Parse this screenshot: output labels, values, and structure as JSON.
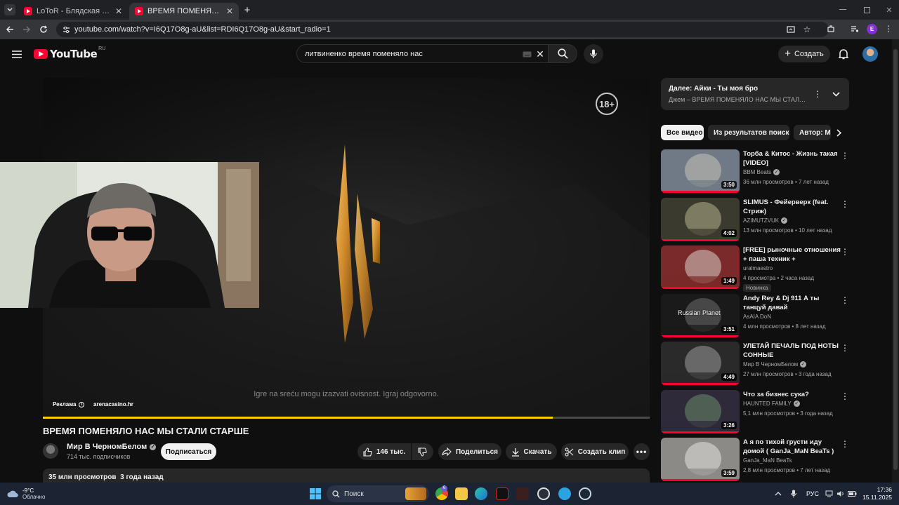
{
  "browser": {
    "tabs": [
      {
        "title": "LoToR - Блядская натура - YouT",
        "active": false
      },
      {
        "title": "ВРЕМЯ ПОМЕНЯЛО НАС МЫ С",
        "active": true
      }
    ],
    "new_tab_label": "+",
    "url": "youtube.com/watch?v=I6Q17O8g-aU&list=RDI6Q17O8g-aU&start_radio=1",
    "profile_letter": "E"
  },
  "youtube": {
    "logo_text": "YouTube",
    "country_code": "RU",
    "search_query": "литвиненко время поменяло нас",
    "create_label": "Создать"
  },
  "player": {
    "age_badge": "18+",
    "disclaimer": "Igre na sreću mogu izazvati ovisnost. Igraj odgovorno.",
    "ad_label": "Реклама",
    "ad_site": "arenacasino.hr",
    "progress_fraction": 0.84
  },
  "video": {
    "title": "ВРЕМЯ ПОМЕНЯЛО НАС МЫ СТАЛИ СТАРШЕ",
    "channel": "Мир В ЧерномБелом",
    "subscribers": "714 тыс. подписчиков",
    "subscribe_label": "Подписаться",
    "likes": "146 тыс.",
    "share_label": "Поделиться",
    "download_label": "Скачать",
    "clip_label": "Создать клип",
    "views_date": "35 млн просмотров  3 года назад"
  },
  "up_next": {
    "title": "Далее: Айки - Ты моя бро",
    "subtitle": "Джем – ВРЕМЯ ПОМЕНЯЛО НАС МЫ СТАЛИ СТА..."
  },
  "chips": [
    "Все видео",
    "Из результатов поиска",
    "Автор: Мир"
  ],
  "recommendations": [
    {
      "title": "Торба & Китос - Жизнь такая [VIDEO]",
      "channel": "BBM Beats",
      "verified": true,
      "meta": "36 млн просмотров • 7 лет назад",
      "duration": "3:50",
      "colors": [
        "#6f7a86",
        "#c9c2b8"
      ],
      "badge": ""
    },
    {
      "title": "SLIMUS  - Фейерверк (feat. Стриж)",
      "channel": "AZIMUTZVUK",
      "verified": true,
      "meta": "13 млн просмотров • 10 лет назад",
      "duration": "4:02",
      "colors": [
        "#3a3a2f",
        "#b6b08e"
      ],
      "badge": ""
    },
    {
      "title": "[FREE] рыночные отношения + паша техник + ежемесячные...",
      "channel": "uralmaestro",
      "verified": false,
      "meta": "4 просмотра • 2 часа назад",
      "duration": "1:49",
      "colors": [
        "#7a2a2a",
        "#d8d0c8"
      ],
      "badge": "Новинка"
    },
    {
      "title": "Andy Rey & Dj 911   А ты танцуй давай",
      "channel": "AsAIA DoN",
      "verified": false,
      "meta": "4 млн просмотров • 8 лет назад",
      "duration": "3:51",
      "colors": [
        "#1a1a1a",
        "#6d6d6d"
      ],
      "badge": "",
      "overlay": "Russian Planet"
    },
    {
      "title": "УЛЕТАЙ ПЕЧАЛЬ ПОД НОТЫ СОННЫЕ",
      "channel": "Мир В ЧерномБелом",
      "verified": true,
      "meta": "27 млн просмотров • 3 года назад",
      "duration": "4:49",
      "colors": [
        "#2a2a2a",
        "#9a9a9a"
      ],
      "badge": ""
    },
    {
      "title": "Что за бизнес сука?",
      "channel": "HAUNTED FAMILY",
      "verified": true,
      "meta": "5,1 млн просмотров • 3 года назад",
      "duration": "3:26",
      "colors": [
        "#2e2a3a",
        "#6b8a6a"
      ],
      "badge": ""
    },
    {
      "title": "А я по тихой грусти иду домой ( GanJa_MaN BeaTs )",
      "channel": "GanJa_MaN BeaTs",
      "verified": false,
      "meta": "2,8 млн просмотров • 7 лет назад",
      "duration": "3:59",
      "colors": [
        "#8c8a86",
        "#e6e4e0"
      ],
      "badge": ""
    }
  ],
  "taskbar": {
    "weather_temp": "-9°C",
    "weather_desc": "Облачно",
    "search_placeholder": "Поиск",
    "lang": "РУС",
    "time": "17:36",
    "date": "15.11.2025",
    "mail_badge": "6"
  }
}
